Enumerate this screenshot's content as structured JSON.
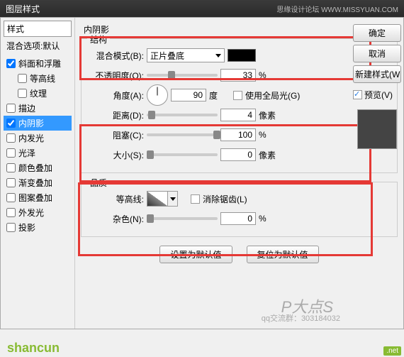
{
  "titlebar": {
    "title": "图层样式",
    "right": "思缘设计论坛 WWW.MISSYUAN.COM"
  },
  "left": {
    "styles_header": "样式",
    "blend_header": "混合选项:默认",
    "items": [
      {
        "label": "斜面和浮雕",
        "checked": true,
        "indent": false
      },
      {
        "label": "等高线",
        "checked": false,
        "indent": true
      },
      {
        "label": "纹理",
        "checked": false,
        "indent": true
      },
      {
        "label": "描边",
        "checked": false,
        "indent": false
      },
      {
        "label": "内阴影",
        "checked": true,
        "indent": false,
        "selected": true
      },
      {
        "label": "内发光",
        "checked": false,
        "indent": false
      },
      {
        "label": "光泽",
        "checked": false,
        "indent": false
      },
      {
        "label": "颜色叠加",
        "checked": false,
        "indent": false
      },
      {
        "label": "渐变叠加",
        "checked": false,
        "indent": false
      },
      {
        "label": "图案叠加",
        "checked": false,
        "indent": false
      },
      {
        "label": "外发光",
        "checked": false,
        "indent": false
      },
      {
        "label": "投影",
        "checked": false,
        "indent": false
      }
    ]
  },
  "panel": {
    "title": "内阴影",
    "structure": {
      "label": "结构",
      "blend_mode_label": "混合模式(B):",
      "blend_mode_value": "正片叠底",
      "opacity_label": "不透明度(O):",
      "opacity_value": "33",
      "opacity_unit": "%",
      "angle_label": "角度(A):",
      "angle_value": "90",
      "angle_unit": "度",
      "global_light_label": "使用全局光(G)",
      "distance_label": "距离(D):",
      "distance_value": "4",
      "distance_unit": "像素",
      "choke_label": "阻塞(C):",
      "choke_value": "100",
      "choke_unit": "%",
      "size_label": "大小(S):",
      "size_value": "0",
      "size_unit": "像素"
    },
    "quality": {
      "label": "品质",
      "contour_label": "等高线:",
      "antialias_label": "消除锯齿(L)",
      "noise_label": "杂色(N):",
      "noise_value": "0",
      "noise_unit": "%"
    },
    "buttons": {
      "default": "设置为默认值",
      "reset": "复位为默认值"
    }
  },
  "side": {
    "ok": "确定",
    "cancel": "取消",
    "new_style": "新建样式(W",
    "preview_label": "预览(V)"
  },
  "watermark": {
    "text1": "P大点S",
    "text2": "qq交流群：303184032",
    "logo": "shancun",
    "net": ".net"
  }
}
